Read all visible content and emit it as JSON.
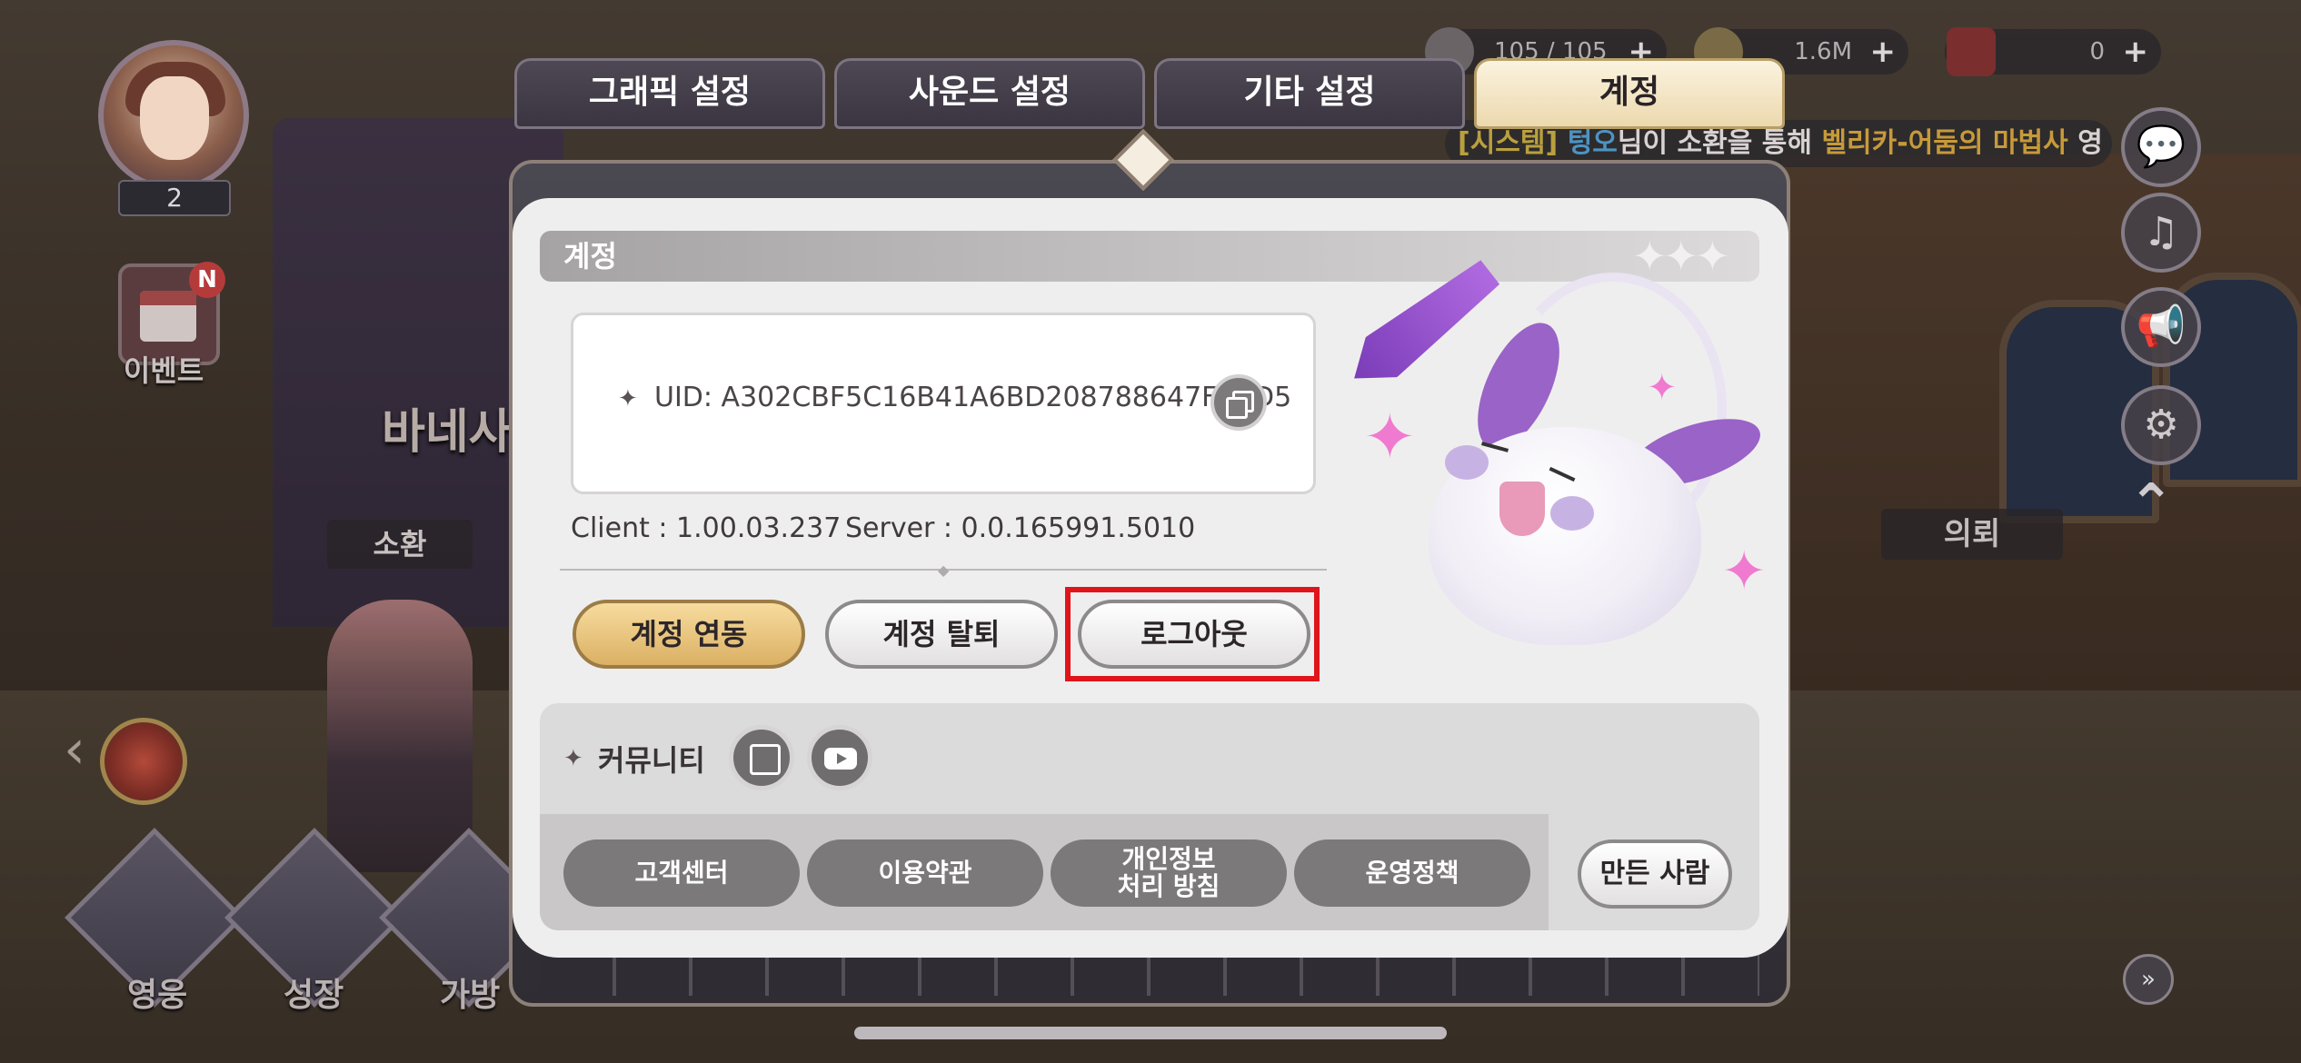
{
  "tabs": [
    {
      "label": "그래픽 설정",
      "active": false
    },
    {
      "label": "사운드 설정",
      "active": false
    },
    {
      "label": "기타 설정",
      "active": false
    },
    {
      "label": "계정",
      "active": true
    }
  ],
  "hud": {
    "player_level": "2",
    "event_label": "이벤트",
    "event_badge": "N",
    "town_name": "바네사",
    "summon_label": "소환",
    "quest_label": "의뢰",
    "nav": {
      "hero": "영웅",
      "growth": "성장",
      "bag": "가방"
    },
    "resources": {
      "stamina": "105 / 105",
      "gold": "1.6M",
      "gems": "0"
    },
    "system_message": {
      "prefix": "[시스템]",
      "nickname": "텅오",
      "middle": "님이 소환을 통해",
      "item": "벨리카-어둠의 마법사",
      "suffix": "영"
    }
  },
  "account": {
    "section_title": "계정",
    "uid_text": "UID: A302CBF5C16B41A6BD208788647F2AD5",
    "client_version": "Client : 1.00.03.237",
    "server_version": "Server : 0.0.165991.5010",
    "buttons": {
      "link": "계정 연동",
      "withdraw": "계정 탈퇴",
      "logout": "로그아웃"
    }
  },
  "community": {
    "label": "커뮤니티",
    "links": [
      "고객센터",
      "이용약관",
      "개인정보\n처리 방침",
      "운영정책"
    ],
    "credits": "만든 사람"
  },
  "colors": {
    "highlight": "#e0141b",
    "gold_button": "#dbb064",
    "tab_active": "#ecd9ae"
  }
}
